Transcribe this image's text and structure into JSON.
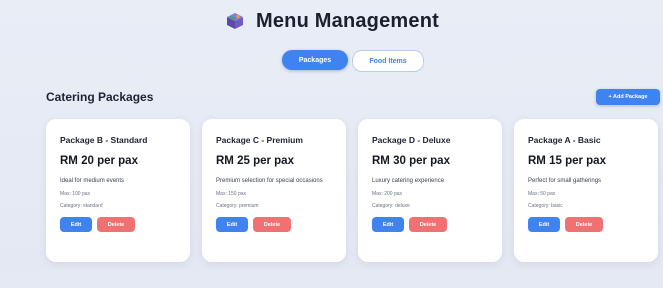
{
  "header": {
    "title": "Menu Management"
  },
  "tabs": [
    {
      "label": "Packages",
      "active": true
    },
    {
      "label": "Food Items",
      "active": false
    }
  ],
  "section": {
    "title": "Catering Packages",
    "add_button": "+ Add Package"
  },
  "packages": [
    {
      "name": "Package B - Standard",
      "price": "RM 20 per pax",
      "description": "Ideal for medium events",
      "max": "Max: 100 pax",
      "category": "Category: standard",
      "edit": "Edit",
      "delete": "Delete"
    },
    {
      "name": "Package C - Premium",
      "price": "RM 25 per pax",
      "description": "Premium selection for special occasions",
      "max": "Max: 150 pax",
      "category": "Category: premium",
      "edit": "Edit",
      "delete": "Delete"
    },
    {
      "name": "Package D - Deluxe",
      "price": "RM 30 per pax",
      "description": "Luxury catering experience",
      "max": "Max: 200 pax",
      "category": "Category: deluxe",
      "edit": "Edit",
      "delete": "Delete"
    },
    {
      "name": "Package A - Basic",
      "price": "RM 15 per pax",
      "description": "Perfect for small gatherings",
      "max": "Max: 50 pax",
      "category": "Category: basic",
      "edit": "Edit",
      "delete": "Delete"
    }
  ],
  "icons": {
    "logo": "takeout-box-icon"
  },
  "colors": {
    "accent": "#3f83f0",
    "danger": "#f07171",
    "background": "#e9edf6"
  }
}
